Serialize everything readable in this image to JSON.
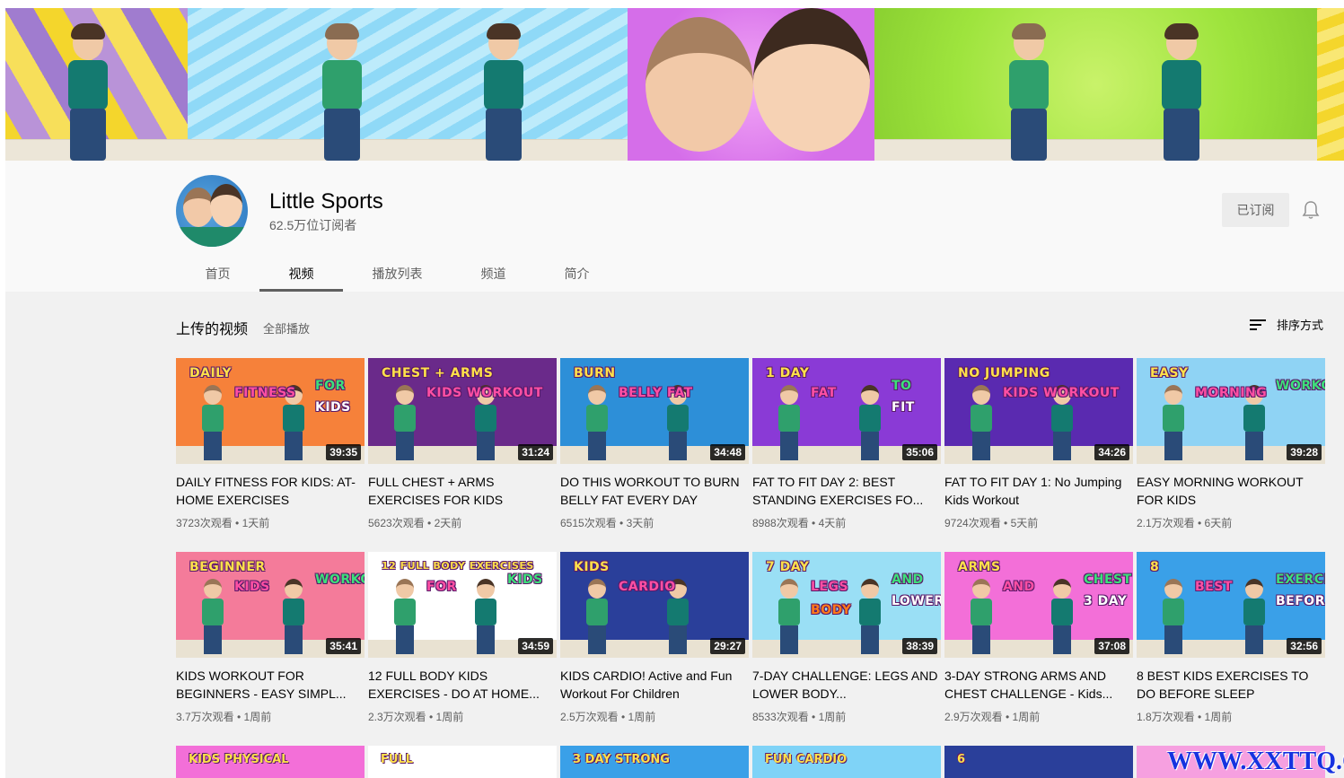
{
  "channel": {
    "name": "Little Sports",
    "subscribers": "62.5万位订阅者",
    "subscribe_button": "已订阅"
  },
  "tabs": [
    {
      "label": "首页"
    },
    {
      "label": "视频"
    },
    {
      "label": "播放列表"
    },
    {
      "label": "频道"
    },
    {
      "label": "简介"
    }
  ],
  "section": {
    "title": "上传的视频",
    "play_all": "全部播放",
    "sort_label": "排序方式"
  },
  "videos": [
    {
      "title": "DAILY FITNESS FOR KIDS: AT-HOME EXERCISES",
      "duration": "39:35",
      "views": "3723次观看",
      "age": "1天前",
      "thumb": {
        "bg": "#f6813a",
        "texts": [
          "DAILY",
          "FITNESS",
          "FOR",
          "KIDS"
        ]
      }
    },
    {
      "title": "FULL CHEST + ARMS EXERCISES FOR KIDS",
      "duration": "31:24",
      "views": "5623次观看",
      "age": "2天前",
      "thumb": {
        "bg": "#6a2a8a",
        "texts": [
          "CHEST + ARMS",
          "KIDS WORKOUT"
        ]
      }
    },
    {
      "title": "DO THIS WORKOUT TO BURN BELLY FAT EVERY DAY",
      "duration": "34:48",
      "views": "6515次观看",
      "age": "3天前",
      "thumb": {
        "bg": "#2d8fd8",
        "texts": [
          "BURN",
          "BELLY FAT"
        ]
      }
    },
    {
      "title": "FAT TO FIT DAY 2: BEST STANDING EXERCISES FO...",
      "duration": "35:06",
      "views": "8988次观看",
      "age": "4天前",
      "thumb": {
        "bg": "#8a3ad6",
        "texts": [
          "1 DAY",
          "FAT",
          "TO",
          "FIT"
        ]
      }
    },
    {
      "title": "FAT TO FIT DAY 1: No Jumping Kids Workout",
      "duration": "34:26",
      "views": "9724次观看",
      "age": "5天前",
      "thumb": {
        "bg": "#5a2ab0",
        "texts": [
          "NO JUMPING",
          "KIDS WORKOUT"
        ]
      }
    },
    {
      "title": "EASY MORNING WORKOUT FOR KIDS",
      "duration": "39:28",
      "views": "2.1万次观看",
      "age": "6天前",
      "thumb": {
        "bg": "#8fd3f4",
        "texts": [
          "EASY",
          "MORNING",
          "WORKOUT"
        ]
      }
    },
    {
      "title": "KIDS WORKOUT FOR BEGINNERS - EASY SIMPL...",
      "duration": "35:41",
      "views": "3.7万次观看",
      "age": "1周前",
      "thumb": {
        "bg": "#f47b9a",
        "texts": [
          "BEGINNER",
          "KIDS",
          "WORKOUT"
        ]
      }
    },
    {
      "title": "12 FULL BODY KIDS EXERCISES - DO AT HOME...",
      "duration": "34:59",
      "views": "2.3万次观看",
      "age": "1周前",
      "thumb": {
        "bg": "#ffffff",
        "texts": [
          "12 FULL BODY EXERCISES",
          "FOR",
          "KIDS"
        ]
      }
    },
    {
      "title": "KIDS CARDIO! Active and Fun Workout For Children",
      "duration": "29:27",
      "views": "2.5万次观看",
      "age": "1周前",
      "thumb": {
        "bg": "#2a3f9a",
        "texts": [
          "KIDS",
          "CARDIO"
        ]
      }
    },
    {
      "title": "7-DAY CHALLENGE: LEGS AND LOWER BODY...",
      "duration": "38:39",
      "views": "8533次观看",
      "age": "1周前",
      "thumb": {
        "bg": "#9adff5",
        "texts": [
          "7 DAY",
          "LEGS",
          "AND",
          "LOWER",
          "BODY"
        ]
      }
    },
    {
      "title": "3-DAY STRONG ARMS AND CHEST CHALLENGE - Kids...",
      "duration": "37:08",
      "views": "2.9万次观看",
      "age": "1周前",
      "thumb": {
        "bg": "#f36fd8",
        "texts": [
          "ARMS",
          "AND",
          "CHEST",
          "3 DAY"
        ]
      }
    },
    {
      "title": "8 BEST KIDS EXERCISES TO DO BEFORE SLEEP",
      "duration": "32:56",
      "views": "1.8万次观看",
      "age": "1周前",
      "thumb": {
        "bg": "#3aa0e8",
        "texts": [
          "8",
          "BEST",
          "EXERCISES",
          "BEFORE SLEEP"
        ]
      }
    }
  ],
  "partial_row": [
    {
      "bg": "#f36fd8",
      "text": "KIDS PHYSICAL"
    },
    {
      "bg": "#ffffff",
      "text": "FULL"
    },
    {
      "bg": "#3aa0e8",
      "text": "3 DAY STRONG"
    },
    {
      "bg": "#7fd3f7",
      "text": "FUN CARDIO"
    },
    {
      "bg": "#2a3f9a",
      "text": "6"
    },
    {
      "bg": "#f6a0e0",
      "text": ""
    }
  ],
  "watermark": "WWW.XXTTQ.COM"
}
